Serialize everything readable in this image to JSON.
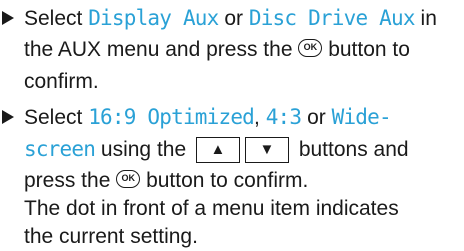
{
  "step1": {
    "select": "Select",
    "opt1": "Display Aux",
    "or": "or",
    "opt2": "Disc Drive Aux",
    "in": "in",
    "l2a": "the AUX menu and press the",
    "l2b": "button to",
    "l3": "confirm."
  },
  "step2": {
    "select": "Select",
    "opt1": "16:9 Optimized",
    "comma": ",",
    "opt2": "4:3",
    "or": "or",
    "opt3a": "Wide-",
    "opt3b": "screen",
    "using": "using the",
    "buttons": "buttons and",
    "press": "press the",
    "confirm": "button to confirm.",
    "note1": "The dot in front of a menu item indicates",
    "note2": "the current setting."
  },
  "icons": {
    "ok_glyph": "OK",
    "up_glyph": "▲",
    "down_glyph": "▼"
  },
  "colors": {
    "menu_text": "#2aa1d6",
    "body_text": "#1a1a1a"
  }
}
